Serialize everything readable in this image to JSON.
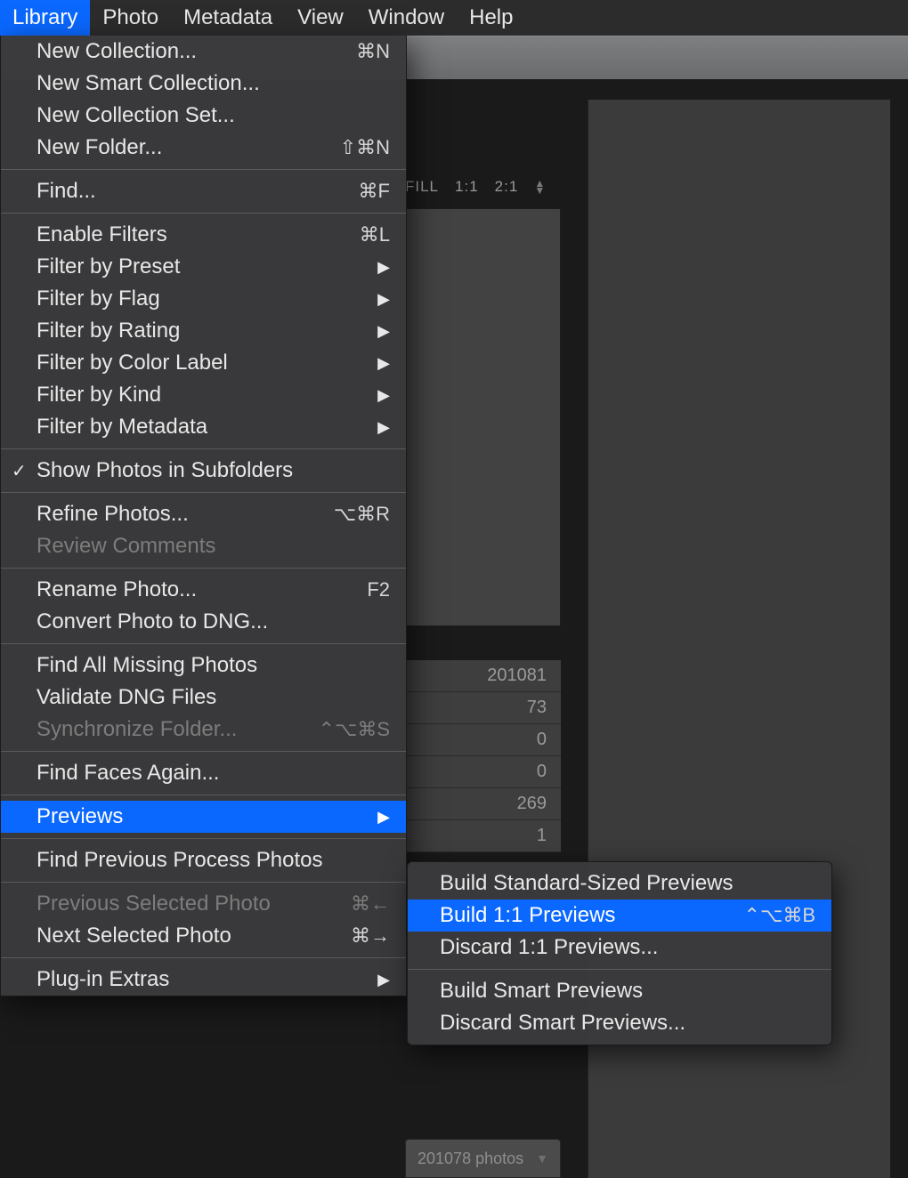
{
  "menubar": {
    "items": [
      {
        "label": "Library"
      },
      {
        "label": "Photo"
      },
      {
        "label": "Metadata"
      },
      {
        "label": "View"
      },
      {
        "label": "Window"
      },
      {
        "label": "Help"
      }
    ]
  },
  "nav": {
    "fill": "FILL",
    "ratio1": "1:1",
    "ratio2": "2:1"
  },
  "counts": [
    "201081",
    "73",
    "0",
    "0",
    "269",
    "1"
  ],
  "footer": {
    "text": "201078 photos"
  },
  "dropdown": {
    "items": [
      {
        "label": "New Collection...",
        "shortcut": "⌘N"
      },
      {
        "label": "New Smart Collection..."
      },
      {
        "label": "New Collection Set..."
      },
      {
        "label": "New Folder...",
        "shortcut": "⇧⌘N"
      },
      {
        "sep": true
      },
      {
        "label": "Find...",
        "shortcut": "⌘F"
      },
      {
        "sep": true
      },
      {
        "label": "Enable Filters",
        "shortcut": "⌘L"
      },
      {
        "label": "Filter by Preset",
        "submenu": true
      },
      {
        "label": "Filter by Flag",
        "submenu": true
      },
      {
        "label": "Filter by Rating",
        "submenu": true
      },
      {
        "label": "Filter by Color Label",
        "submenu": true
      },
      {
        "label": "Filter by Kind",
        "submenu": true
      },
      {
        "label": "Filter by Metadata",
        "submenu": true
      },
      {
        "sep": true
      },
      {
        "label": "Show Photos in Subfolders",
        "checked": true
      },
      {
        "sep": true
      },
      {
        "label": "Refine Photos...",
        "shortcut": "⌥⌘R"
      },
      {
        "label": "Review Comments",
        "disabled": true
      },
      {
        "sep": true
      },
      {
        "label": "Rename Photo...",
        "shortcut": "F2"
      },
      {
        "label": "Convert Photo to DNG..."
      },
      {
        "sep": true
      },
      {
        "label": "Find All Missing Photos"
      },
      {
        "label": "Validate DNG Files"
      },
      {
        "label": "Synchronize Folder...",
        "shortcut": "⌃⌥⌘S",
        "disabled": true
      },
      {
        "sep": true
      },
      {
        "label": "Find Faces Again..."
      },
      {
        "sep": true
      },
      {
        "label": "Previews",
        "submenu": true,
        "highlight": true
      },
      {
        "sep": true
      },
      {
        "label": "Find Previous Process Photos"
      },
      {
        "sep": true
      },
      {
        "label": "Previous Selected Photo",
        "shortcut": "⌘←",
        "disabled": true
      },
      {
        "label": "Next Selected Photo",
        "shortcut": "⌘→"
      },
      {
        "sep": true
      },
      {
        "label": "Plug-in Extras",
        "submenu": true
      }
    ]
  },
  "submenu": {
    "items": [
      {
        "label": "Build Standard-Sized Previews"
      },
      {
        "label": "Build 1:1 Previews",
        "shortcut": "⌃⌥⌘B",
        "highlight": true
      },
      {
        "label": "Discard 1:1 Previews..."
      },
      {
        "sep": true
      },
      {
        "label": "Build Smart Previews"
      },
      {
        "label": "Discard Smart Previews..."
      }
    ]
  }
}
